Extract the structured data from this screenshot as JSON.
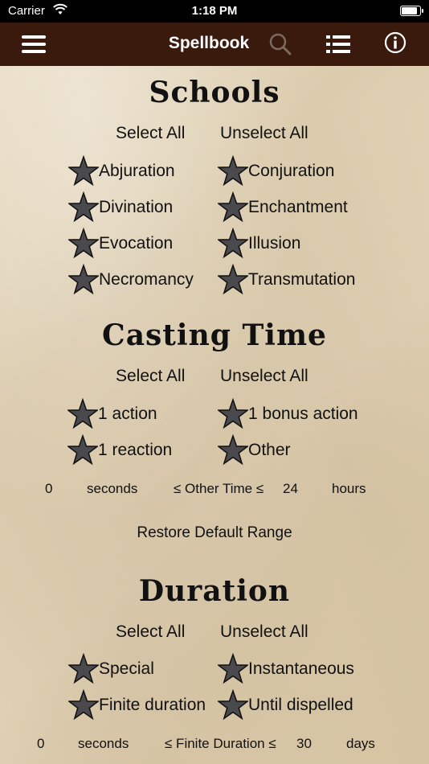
{
  "status": {
    "carrier": "Carrier",
    "time": "1:18 PM"
  },
  "nav": {
    "title": "Spellbook"
  },
  "icons": {
    "menu": "hamburger-icon",
    "search": "search-icon",
    "list": "list-icon",
    "info": "info-icon",
    "star": "star-icon"
  },
  "colors": {
    "nav_bg": "#3a1a0c",
    "star_fill": "#4a4a4e"
  },
  "schools": {
    "heading": "Schools",
    "select_all": "Select All",
    "unselect_all": "Unselect All",
    "options": [
      "Abjuration",
      "Conjuration",
      "Divination",
      "Enchantment",
      "Evocation",
      "Illusion",
      "Necromancy",
      "Transmutation"
    ]
  },
  "casting": {
    "heading": "Casting Time",
    "select_all": "Select All",
    "unselect_all": "Unselect All",
    "options": [
      "1 action",
      "1 bonus action",
      "1 reaction",
      "Other"
    ],
    "range": {
      "min": "0",
      "min_unit": "seconds",
      "label": "≤ Other Time ≤",
      "max": "24",
      "max_unit": "hours"
    },
    "restore": "Restore Default Range"
  },
  "duration": {
    "heading": "Duration",
    "select_all": "Select All",
    "unselect_all": "Unselect All",
    "options": [
      "Special",
      "Instantaneous",
      "Finite duration",
      "Until dispelled"
    ],
    "range": {
      "min": "0",
      "min_unit": "seconds",
      "label": "≤ Finite Duration ≤",
      "max": "30",
      "max_unit": "days"
    }
  }
}
